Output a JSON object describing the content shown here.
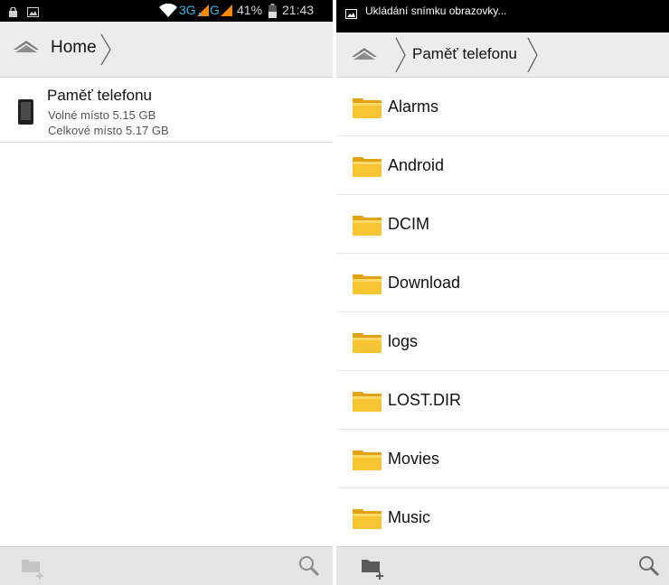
{
  "left_screen": {
    "status_bar": {
      "network_3g": "3G",
      "network_g": "G",
      "battery_percent": "41%",
      "time": "21:43",
      "accent_color": "#33b5e5",
      "signal_color": "#ff8800"
    },
    "breadcrumb": {
      "home_icon": "home-icon",
      "current": "Home"
    },
    "storage": {
      "name": "Paměť telefonu",
      "free": "Volné místo 5.15 GB",
      "total": "Celkové místo 5.17 GB",
      "icon": "phone-icon"
    },
    "bottom_bar": {
      "new_folder_icon": "new-folder-icon",
      "search_icon": "search-icon"
    }
  },
  "right_screen": {
    "notification": {
      "text": "Ukládání snímku obrazovky...",
      "icon": "screenshot-icon"
    },
    "breadcrumb": {
      "home_icon": "home-icon",
      "current": "Paměť telefonu"
    },
    "folders": [
      {
        "name": "Alarms"
      },
      {
        "name": "Android"
      },
      {
        "name": "DCIM"
      },
      {
        "name": "Download"
      },
      {
        "name": "logs"
      },
      {
        "name": "LOST.DIR"
      },
      {
        "name": "Movies"
      },
      {
        "name": "Music"
      }
    ],
    "folder_icon": "folder-icon",
    "bottom_bar": {
      "new_folder_icon": "new-folder-icon",
      "search_icon": "search-icon"
    }
  }
}
